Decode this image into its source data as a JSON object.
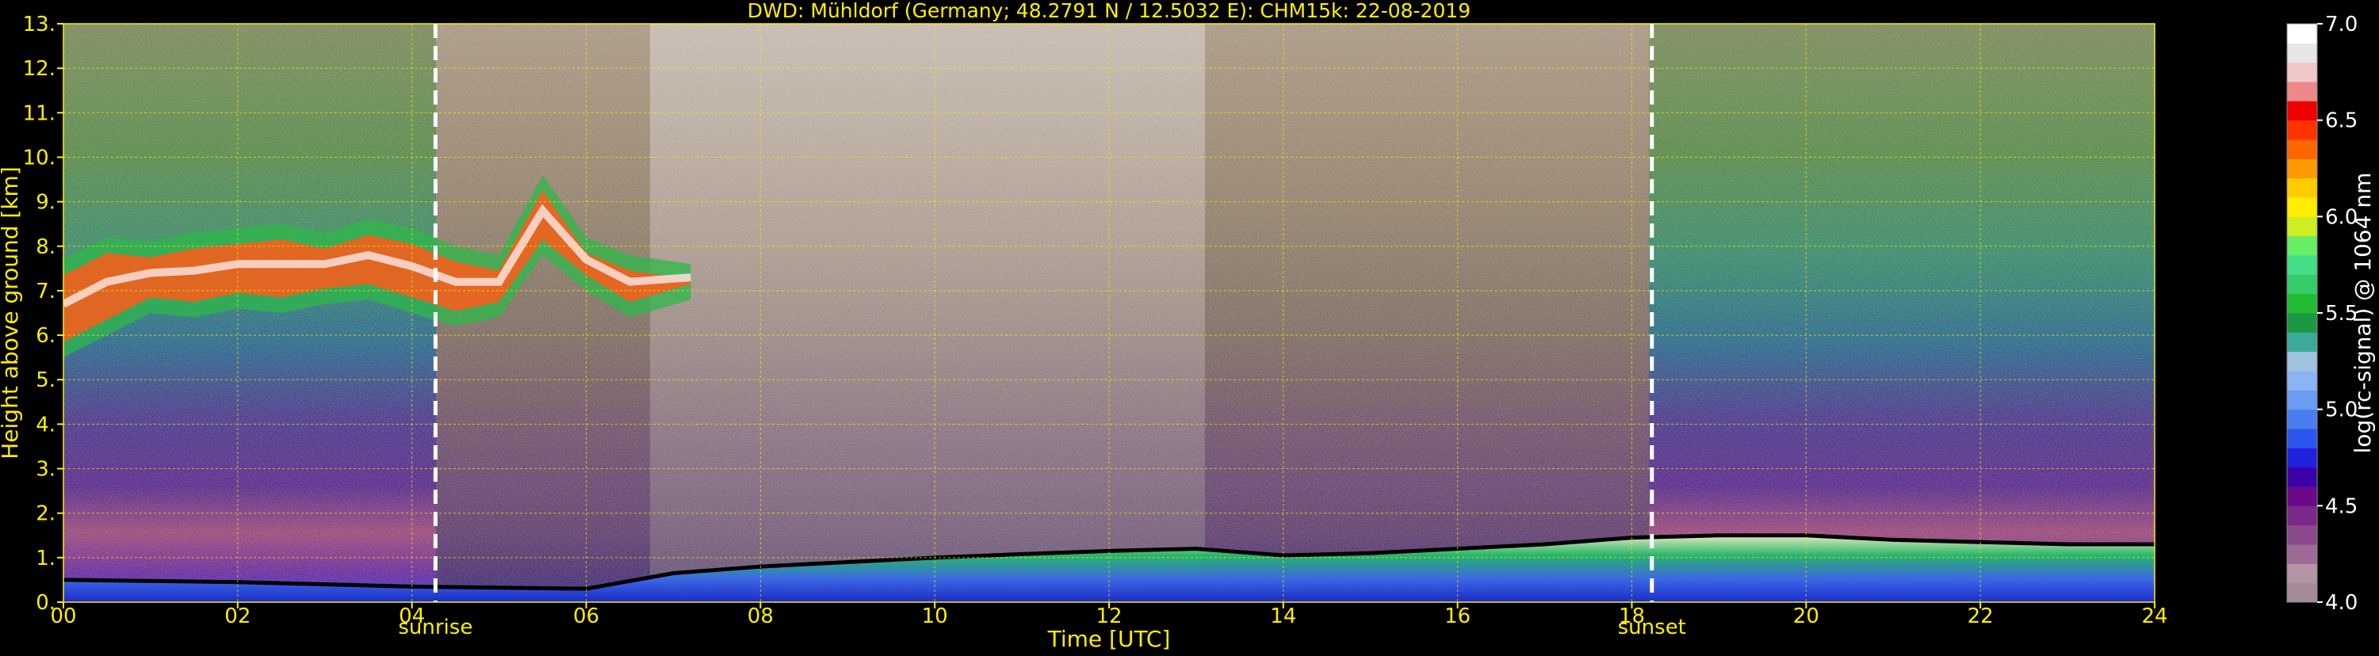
{
  "chart_data": {
    "type": "heatmap",
    "title": "DWD: Mühldorf (Germany; 48.2791 N / 12.5032 E):    CHM15k: 22-08-2019",
    "xlabel": "Time [UTC]",
    "ylabel": "Height above ground [km]",
    "xlim": [
      0,
      24
    ],
    "ylim": [
      0,
      13
    ],
    "x_ticks": [
      0,
      2,
      4,
      6,
      8,
      10,
      12,
      14,
      16,
      18,
      20,
      22,
      24
    ],
    "x_tick_labels": [
      "00",
      "02",
      "04",
      "06",
      "08",
      "10",
      "12",
      "14",
      "16",
      "18",
      "20",
      "22",
      "24"
    ],
    "y_ticks": [
      0,
      1,
      2,
      3,
      4,
      5,
      6,
      7,
      8,
      9,
      10,
      11,
      12,
      13
    ],
    "y_tick_labels": [
      "0.",
      "1.",
      "2.",
      "3.",
      "4.",
      "5.",
      "6.",
      "7.",
      "8.",
      "9.",
      "10.",
      "11.",
      "12.",
      "13."
    ],
    "grid": true,
    "markers": [
      {
        "label": "sunrise",
        "x": 4.27
      },
      {
        "label": "sunset",
        "x": 18.23
      }
    ],
    "colorbar": {
      "label": "log(rc-signal) @ 1064 nm",
      "range": [
        4.0,
        7.0
      ],
      "ticks": [
        "4.0",
        "4.5",
        "5.0",
        "5.5",
        "6.0",
        "6.5",
        "7.0"
      ],
      "colors": [
        "#a58b99",
        "#b495a5",
        "#9d6b95",
        "#8a4a8c",
        "#7a2a88",
        "#6a0a8a",
        "#3c00a8",
        "#2020e0",
        "#2c55ee",
        "#4a7ef0",
        "#6b9cf2",
        "#8cb4f4",
        "#a0c4e0",
        "#3caa99",
        "#1a9944",
        "#22bb33",
        "#33cc66",
        "#44dd88",
        "#66ee66",
        "#ccee22",
        "#ffee00",
        "#ffcc00",
        "#ff9900",
        "#ff6600",
        "#ff3300",
        "#ee0000",
        "#ee8888",
        "#f0c8c8",
        "#e6e6e6",
        "#ffffff"
      ]
    },
    "layers": [
      {
        "name": "cirrus",
        "x": [
          0.0,
          0.5,
          1.0,
          1.5,
          2.0,
          2.5,
          3.0,
          3.5,
          4.0,
          4.5,
          5.0,
          5.5,
          6.0,
          6.5,
          7.2
        ],
        "top": [
          7.7,
          8.2,
          8.1,
          8.3,
          8.4,
          8.5,
          8.3,
          8.6,
          8.4,
          8.0,
          7.8,
          9.6,
          8.2,
          7.8,
          7.6
        ],
        "base": [
          5.5,
          6.0,
          6.5,
          6.4,
          6.6,
          6.5,
          6.7,
          6.8,
          6.5,
          6.2,
          6.4,
          7.8,
          7.0,
          6.4,
          6.8
        ]
      },
      {
        "name": "boundary_layer_top",
        "x": [
          0,
          2,
          4,
          6,
          7,
          8,
          9,
          10,
          11,
          12,
          13,
          14,
          15,
          16,
          17,
          18,
          19,
          20,
          21,
          22,
          23,
          24
        ],
        "values": [
          0.5,
          0.45,
          0.35,
          0.3,
          0.65,
          0.8,
          0.9,
          1.0,
          1.08,
          1.15,
          1.2,
          1.05,
          1.1,
          1.2,
          1.3,
          1.45,
          1.5,
          1.5,
          1.4,
          1.35,
          1.3,
          1.3
        ]
      }
    ]
  }
}
